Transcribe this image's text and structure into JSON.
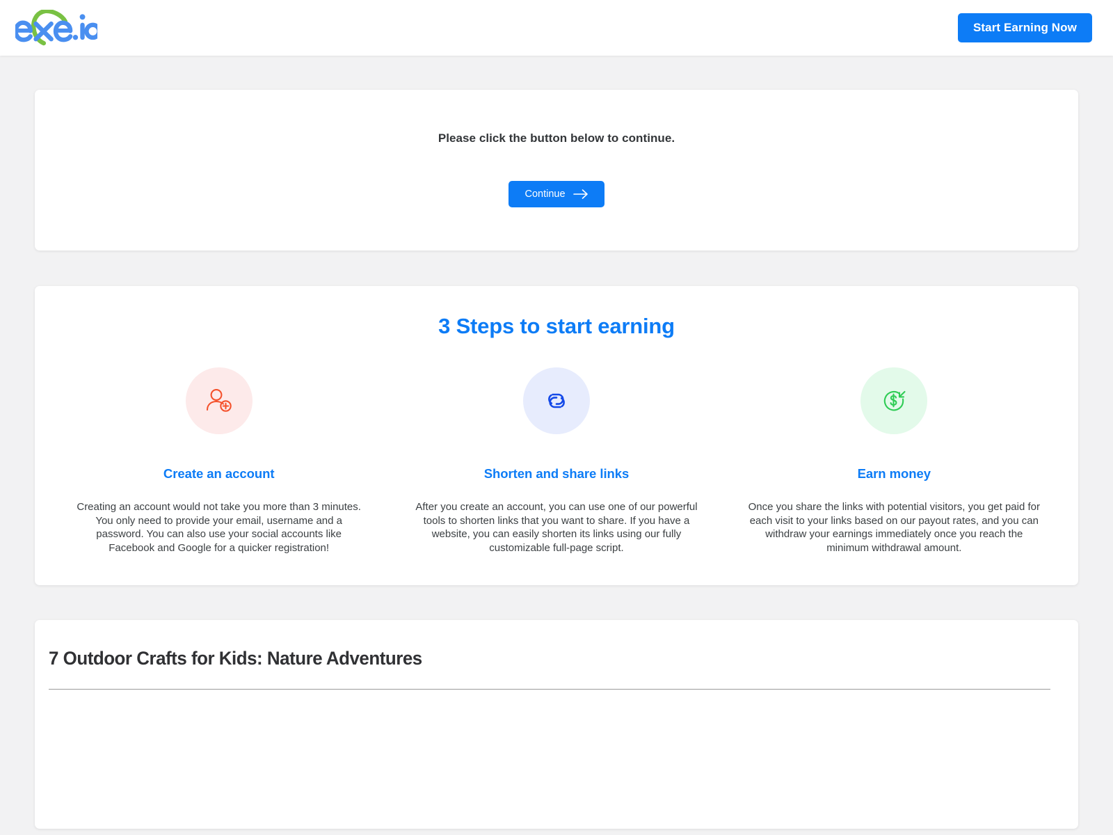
{
  "header": {
    "logo_text": "exe.io",
    "logo_icon": "exe-io-logo",
    "cta_label": "Start Earning Now"
  },
  "continue_section": {
    "message": "Please click the button below to continue.",
    "button_label": "Continue",
    "button_icon": "arrow-right-icon"
  },
  "steps_section": {
    "title": "3 Steps to start earning",
    "steps": [
      {
        "icon": "user-plus-icon",
        "title": "Create an account",
        "text": "Creating an account would not take you more than 3 minutes. You only need to provide your email, username and a password. You can also use your social accounts like Facebook and Google for a quicker registration!"
      },
      {
        "icon": "link-chain-icon",
        "title": "Shorten and share links",
        "text": "After you create an account, you can use one of our powerful tools to shorten links that you want to share. If you have a website, you can easily shorten its links using our fully customizable full-page script."
      },
      {
        "icon": "dollar-arrow-in-icon",
        "title": "Earn money",
        "text": "Once you share the links with potential visitors, you get paid for each visit to your links based on our payout rates, and you can withdraw your earnings immediately once you reach the minimum withdrawal amount."
      }
    ]
  },
  "article_section": {
    "title": "7 Outdoor Crafts for Kids: Nature Adventures"
  },
  "colors": {
    "accent_blue": "#0d7cf6",
    "page_background": "#f2f2f3",
    "card_background": "#ffffff",
    "icon_red": "#f4512c",
    "icon_blue": "#1449e8",
    "icon_green": "#2fcc55",
    "logo_blue": "#4a8ff0",
    "logo_green": "#79c143"
  }
}
